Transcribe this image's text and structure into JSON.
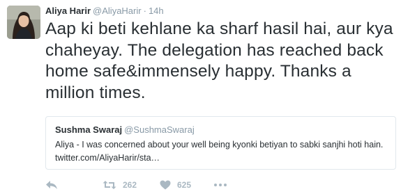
{
  "tweet": {
    "author_name": "Aliya Harir",
    "author_handle": "@AliyaHarir",
    "separator": "·",
    "timestamp": "14h",
    "text": "Aap ki beti kehlane ka sharf hasil hai, aur kya chaheyay. The delegation has reached back home safe&immensely happy. Thanks a million times."
  },
  "quoted_tweet": {
    "author_name": "Sushma Swaraj",
    "author_handle": "@SushmaSwaraj",
    "text": "Aliya - I was concerned about your well being kyonki betiyan to sabki sanjhi hoti hain. twitter.com/AliyaHarir/sta…"
  },
  "actions": {
    "retweet_count": "262",
    "like_count": "625",
    "icons": [
      "reply-icon",
      "retweet-icon",
      "heart-icon",
      "more-icon"
    ]
  },
  "colors": {
    "text": "#292f33",
    "secondary": "#8899a6",
    "action_gray": "#aab8c2",
    "border": "#e1e8ed"
  }
}
